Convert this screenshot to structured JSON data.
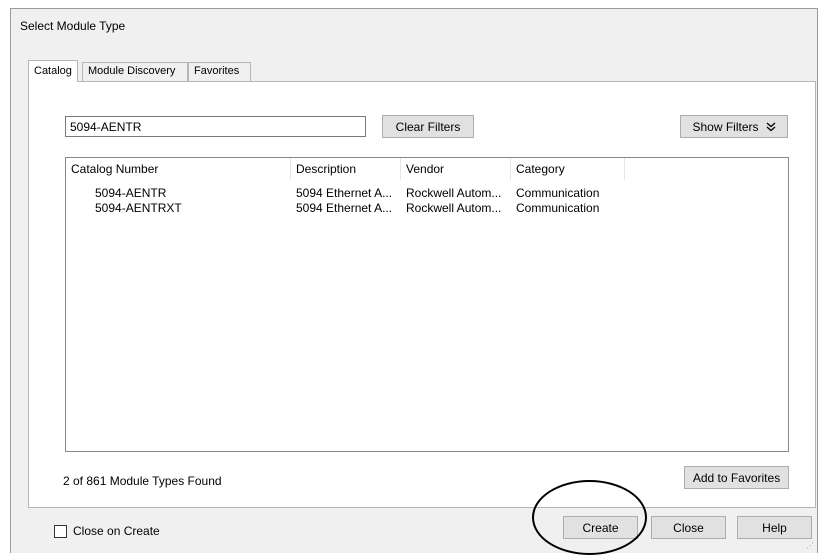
{
  "dialog": {
    "title": "Select Module Type"
  },
  "tabs": [
    {
      "label": "Catalog",
      "active": true
    },
    {
      "label": "Module Discovery",
      "active": false
    },
    {
      "label": "Favorites",
      "active": false
    }
  ],
  "search": {
    "value": "5094-AENTR"
  },
  "buttons": {
    "clear_filters": "Clear Filters",
    "show_filters": "Show Filters",
    "show_filters_icon": "double-chevron-down-icon",
    "add_to_favorites": "Add to Favorites",
    "create": "Create",
    "close": "Close",
    "help": "Help"
  },
  "table": {
    "headers": [
      "Catalog Number",
      "Description",
      "Vendor",
      "Category"
    ],
    "rows": [
      {
        "catalog_number": "5094-AENTR",
        "description": "5094 Ethernet A...",
        "vendor": "Rockwell Autom...",
        "category": "Communication"
      },
      {
        "catalog_number": "5094-AENTRXT",
        "description": "5094 Ethernet A...",
        "vendor": "Rockwell Autom...",
        "category": "Communication"
      }
    ]
  },
  "status": {
    "found": "2 of 861 Module Types Found"
  },
  "close_on_create": {
    "label": "Close on Create",
    "checked": false
  },
  "colors": {
    "dialog_bg": "#f0f0f0",
    "button_bg": "#e1e1e1",
    "annotation_circle": "#000000"
  }
}
